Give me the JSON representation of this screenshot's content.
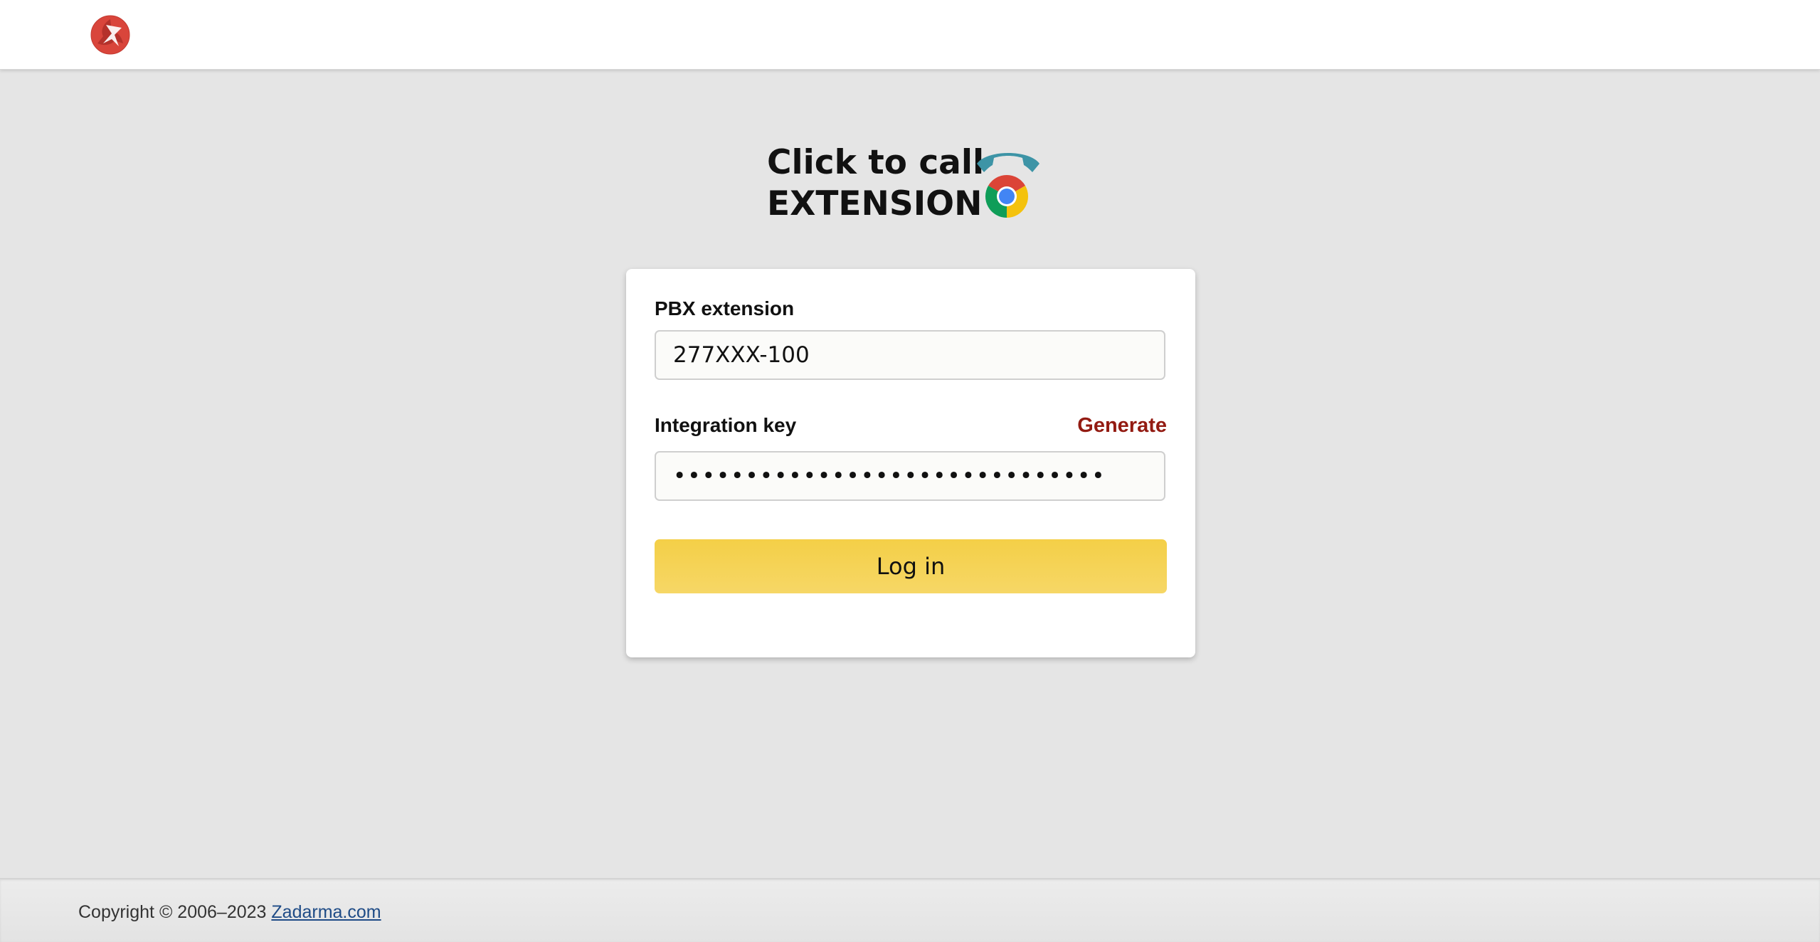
{
  "header": {
    "logo_icon": "zadarma-logo-icon"
  },
  "hero": {
    "line1": "Click to call",
    "line2": "EXTENSION",
    "icon": "phone-chrome-icon",
    "colors": {
      "phone": "#3d94a6",
      "chrome_red": "#db4437",
      "chrome_yellow": "#f4c20d",
      "chrome_green": "#0f9d58",
      "chrome_blue": "#4285f4"
    }
  },
  "form": {
    "pbx_label": "PBX extension",
    "pbx_value": "277XXX-100",
    "key_label": "Integration key",
    "generate_label": "Generate",
    "key_value": "••••••••••••••••••••••••••••••",
    "login_label": "Log in"
  },
  "footer": {
    "copyright": "Copyright © 2006–2023 ",
    "link_text": "Zadarma.com"
  },
  "colors": {
    "accent_button": "#f4cf47",
    "generate_link": "#931b12",
    "page_background": "#e5e5e5",
    "logo": "#d9453b"
  }
}
